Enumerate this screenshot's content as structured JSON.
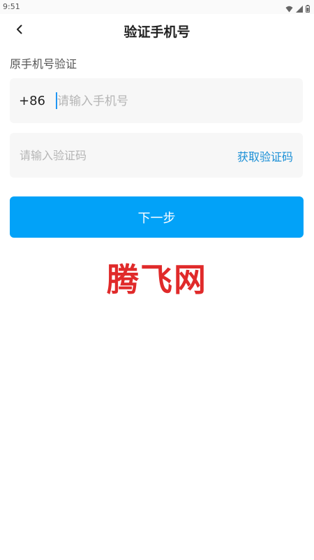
{
  "status_bar": {
    "time": "9:51",
    "icons": [
      "wifi-icon",
      "signal-icon",
      "battery-icon"
    ]
  },
  "header": {
    "title": "验证手机号",
    "back_icon": "chevron-left-icon"
  },
  "section": {
    "label": "原手机号验证"
  },
  "phone_field": {
    "country_code": "+86",
    "placeholder": "请输入手机号",
    "value": ""
  },
  "code_field": {
    "placeholder": "请输入验证码",
    "value": "",
    "get_code_label": "获取验证码"
  },
  "next_button": {
    "label": "下一步"
  },
  "watermark": {
    "text": "腾飞网"
  },
  "colors": {
    "accent": "#02a2f8",
    "link": "#1a8fd6",
    "field_bg": "#f7f7f7",
    "watermark": "#e02a2a"
  }
}
